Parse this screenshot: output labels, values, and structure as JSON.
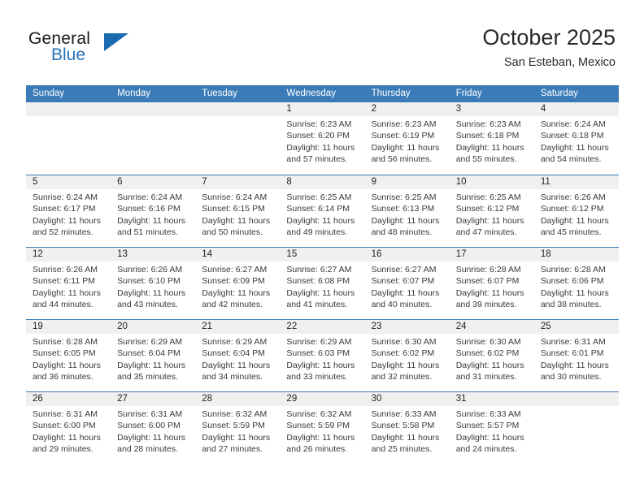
{
  "brand": {
    "word1": "General",
    "word2": "Blue",
    "flag_icon": "triangle-flag-icon",
    "accent_color": "#2572b8"
  },
  "header": {
    "title": "October 2025",
    "subtitle": "San Esteban, Mexico"
  },
  "calendar": {
    "header_bg": "#3b7cb8",
    "daynum_bg": "#f0f0f0",
    "weekday_headers": [
      "Sunday",
      "Monday",
      "Tuesday",
      "Wednesday",
      "Thursday",
      "Friday",
      "Saturday"
    ],
    "weeks": [
      [
        {
          "day": "",
          "sunrise": "",
          "sunset": "",
          "daylight": "",
          "empty": true
        },
        {
          "day": "",
          "sunrise": "",
          "sunset": "",
          "daylight": "",
          "empty": true
        },
        {
          "day": "",
          "sunrise": "",
          "sunset": "",
          "daylight": "",
          "empty": true
        },
        {
          "day": "1",
          "sunrise": "Sunrise: 6:23 AM",
          "sunset": "Sunset: 6:20 PM",
          "daylight": "Daylight: 11 hours and 57 minutes."
        },
        {
          "day": "2",
          "sunrise": "Sunrise: 6:23 AM",
          "sunset": "Sunset: 6:19 PM",
          "daylight": "Daylight: 11 hours and 56 minutes."
        },
        {
          "day": "3",
          "sunrise": "Sunrise: 6:23 AM",
          "sunset": "Sunset: 6:18 PM",
          "daylight": "Daylight: 11 hours and 55 minutes."
        },
        {
          "day": "4",
          "sunrise": "Sunrise: 6:24 AM",
          "sunset": "Sunset: 6:18 PM",
          "daylight": "Daylight: 11 hours and 54 minutes."
        }
      ],
      [
        {
          "day": "5",
          "sunrise": "Sunrise: 6:24 AM",
          "sunset": "Sunset: 6:17 PM",
          "daylight": "Daylight: 11 hours and 52 minutes."
        },
        {
          "day": "6",
          "sunrise": "Sunrise: 6:24 AM",
          "sunset": "Sunset: 6:16 PM",
          "daylight": "Daylight: 11 hours and 51 minutes."
        },
        {
          "day": "7",
          "sunrise": "Sunrise: 6:24 AM",
          "sunset": "Sunset: 6:15 PM",
          "daylight": "Daylight: 11 hours and 50 minutes."
        },
        {
          "day": "8",
          "sunrise": "Sunrise: 6:25 AM",
          "sunset": "Sunset: 6:14 PM",
          "daylight": "Daylight: 11 hours and 49 minutes."
        },
        {
          "day": "9",
          "sunrise": "Sunrise: 6:25 AM",
          "sunset": "Sunset: 6:13 PM",
          "daylight": "Daylight: 11 hours and 48 minutes."
        },
        {
          "day": "10",
          "sunrise": "Sunrise: 6:25 AM",
          "sunset": "Sunset: 6:12 PM",
          "daylight": "Daylight: 11 hours and 47 minutes."
        },
        {
          "day": "11",
          "sunrise": "Sunrise: 6:26 AM",
          "sunset": "Sunset: 6:12 PM",
          "daylight": "Daylight: 11 hours and 45 minutes."
        }
      ],
      [
        {
          "day": "12",
          "sunrise": "Sunrise: 6:26 AM",
          "sunset": "Sunset: 6:11 PM",
          "daylight": "Daylight: 11 hours and 44 minutes."
        },
        {
          "day": "13",
          "sunrise": "Sunrise: 6:26 AM",
          "sunset": "Sunset: 6:10 PM",
          "daylight": "Daylight: 11 hours and 43 minutes."
        },
        {
          "day": "14",
          "sunrise": "Sunrise: 6:27 AM",
          "sunset": "Sunset: 6:09 PM",
          "daylight": "Daylight: 11 hours and 42 minutes."
        },
        {
          "day": "15",
          "sunrise": "Sunrise: 6:27 AM",
          "sunset": "Sunset: 6:08 PM",
          "daylight": "Daylight: 11 hours and 41 minutes."
        },
        {
          "day": "16",
          "sunrise": "Sunrise: 6:27 AM",
          "sunset": "Sunset: 6:07 PM",
          "daylight": "Daylight: 11 hours and 40 minutes."
        },
        {
          "day": "17",
          "sunrise": "Sunrise: 6:28 AM",
          "sunset": "Sunset: 6:07 PM",
          "daylight": "Daylight: 11 hours and 39 minutes."
        },
        {
          "day": "18",
          "sunrise": "Sunrise: 6:28 AM",
          "sunset": "Sunset: 6:06 PM",
          "daylight": "Daylight: 11 hours and 38 minutes."
        }
      ],
      [
        {
          "day": "19",
          "sunrise": "Sunrise: 6:28 AM",
          "sunset": "Sunset: 6:05 PM",
          "daylight": "Daylight: 11 hours and 36 minutes."
        },
        {
          "day": "20",
          "sunrise": "Sunrise: 6:29 AM",
          "sunset": "Sunset: 6:04 PM",
          "daylight": "Daylight: 11 hours and 35 minutes."
        },
        {
          "day": "21",
          "sunrise": "Sunrise: 6:29 AM",
          "sunset": "Sunset: 6:04 PM",
          "daylight": "Daylight: 11 hours and 34 minutes."
        },
        {
          "day": "22",
          "sunrise": "Sunrise: 6:29 AM",
          "sunset": "Sunset: 6:03 PM",
          "daylight": "Daylight: 11 hours and 33 minutes."
        },
        {
          "day": "23",
          "sunrise": "Sunrise: 6:30 AM",
          "sunset": "Sunset: 6:02 PM",
          "daylight": "Daylight: 11 hours and 32 minutes."
        },
        {
          "day": "24",
          "sunrise": "Sunrise: 6:30 AM",
          "sunset": "Sunset: 6:02 PM",
          "daylight": "Daylight: 11 hours and 31 minutes."
        },
        {
          "day": "25",
          "sunrise": "Sunrise: 6:31 AM",
          "sunset": "Sunset: 6:01 PM",
          "daylight": "Daylight: 11 hours and 30 minutes."
        }
      ],
      [
        {
          "day": "26",
          "sunrise": "Sunrise: 6:31 AM",
          "sunset": "Sunset: 6:00 PM",
          "daylight": "Daylight: 11 hours and 29 minutes."
        },
        {
          "day": "27",
          "sunrise": "Sunrise: 6:31 AM",
          "sunset": "Sunset: 6:00 PM",
          "daylight": "Daylight: 11 hours and 28 minutes."
        },
        {
          "day": "28",
          "sunrise": "Sunrise: 6:32 AM",
          "sunset": "Sunset: 5:59 PM",
          "daylight": "Daylight: 11 hours and 27 minutes."
        },
        {
          "day": "29",
          "sunrise": "Sunrise: 6:32 AM",
          "sunset": "Sunset: 5:59 PM",
          "daylight": "Daylight: 11 hours and 26 minutes."
        },
        {
          "day": "30",
          "sunrise": "Sunrise: 6:33 AM",
          "sunset": "Sunset: 5:58 PM",
          "daylight": "Daylight: 11 hours and 25 minutes."
        },
        {
          "day": "31",
          "sunrise": "Sunrise: 6:33 AM",
          "sunset": "Sunset: 5:57 PM",
          "daylight": "Daylight: 11 hours and 24 minutes."
        },
        {
          "day": "",
          "sunrise": "",
          "sunset": "",
          "daylight": "",
          "empty": true
        }
      ]
    ]
  }
}
